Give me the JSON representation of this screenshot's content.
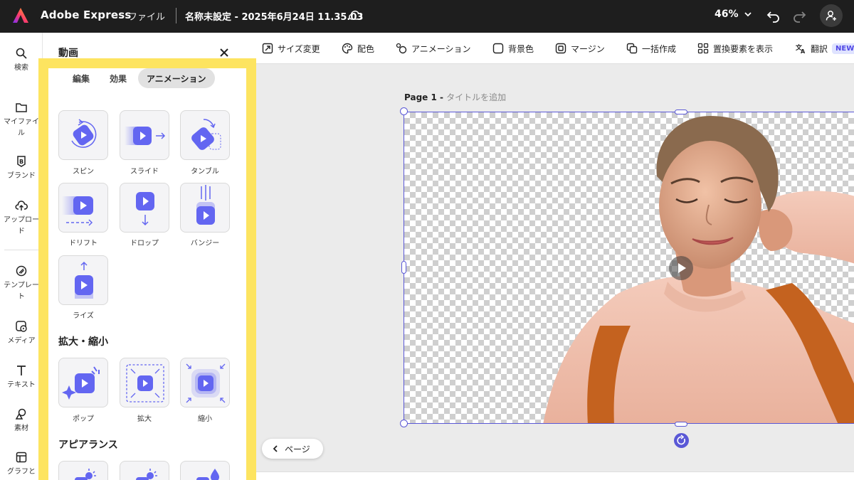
{
  "app": {
    "name": "Adobe Express",
    "file_menu": "ファイル",
    "doc_title": "名称未設定 - 2025年6月24日 11.35.03",
    "zoom": "46%"
  },
  "rail": [
    {
      "label": "検索",
      "icon": "search-icon"
    },
    {
      "label": "マイファイル",
      "icon": "folder-icon"
    },
    {
      "label": "ブランド",
      "icon": "brand-icon"
    },
    {
      "label": "アップロード",
      "icon": "upload-icon"
    },
    {
      "label": "テンプレート",
      "icon": "template-icon"
    },
    {
      "label": "メディア",
      "icon": "media-icon"
    },
    {
      "label": "テキスト",
      "icon": "text-icon"
    },
    {
      "label": "素材",
      "icon": "elements-icon"
    },
    {
      "label": "グラフと",
      "icon": "grid-icon"
    }
  ],
  "panel": {
    "title": "動画",
    "tabs": [
      "編集",
      "効果",
      "アニメーション"
    ],
    "active_tab": "アニメーション",
    "animations": [
      "スピン",
      "スライド",
      "タンブル",
      "ドリフト",
      "ドロップ",
      "バンジー",
      "ライズ"
    ],
    "scale_heading": "拡大・縮小",
    "scale_items": [
      "ポップ",
      "拡大",
      "縮小"
    ],
    "appearance_heading": "アピアランス"
  },
  "toolbar": {
    "resize": "サイズ変更",
    "color": "配色",
    "animation": "アニメーション",
    "background": "背景色",
    "margin": "マージン",
    "batch": "一括作成",
    "replace": "置換要素を表示",
    "translate": "翻訳",
    "new_badge": "NEW"
  },
  "canvas": {
    "page_name": "Page 1 - ",
    "page_title_placeholder": "タイトルを追加",
    "pages_button": "ページ"
  },
  "colors": {
    "accent": "#5a58d6",
    "icon_blue": "#6366f1",
    "highlight": "#fde460"
  }
}
